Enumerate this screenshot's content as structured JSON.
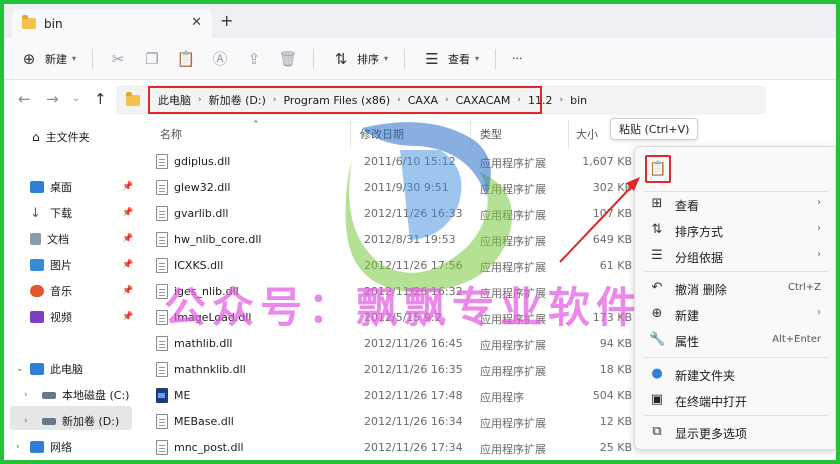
{
  "window": {
    "tab_title": "bin",
    "close_glyph": "✕",
    "add_tab_glyph": "+"
  },
  "toolbar": {
    "new_label": "新建",
    "sort_label": "排序",
    "view_label": "查看",
    "more_glyph": "···"
  },
  "address": {
    "crumbs": [
      "此电脑",
      "新加卷 (D:)",
      "Program Files (x86)",
      "CAXA",
      "CAXACAM",
      "11.2",
      "bin"
    ]
  },
  "sidebar": {
    "home": "主文件夹",
    "quick": [
      "桌面",
      "下载",
      "文档",
      "图片",
      "音乐",
      "视频"
    ],
    "this_pc": "此电脑",
    "drive_c": "本地磁盘 (C:)",
    "drive_d": "新加卷 (D:)",
    "network": "网络"
  },
  "columns": {
    "name": "名称",
    "modified": "修改日期",
    "type": "类型",
    "size": "大小"
  },
  "files": [
    {
      "name": "gdiplus.dll",
      "modified": "2011/6/10 15:12",
      "type": "应用程序扩展",
      "size": "1,607 KB",
      "icon": "dll"
    },
    {
      "name": "glew32.dll",
      "modified": "2011/9/30 9:51",
      "type": "应用程序扩展",
      "size": "302 KB",
      "icon": "dll"
    },
    {
      "name": "gvarlib.dll",
      "modified": "2012/11/26 16:33",
      "type": "应用程序扩展",
      "size": "107 KB",
      "icon": "dll"
    },
    {
      "name": "hw_nlib_core.dll",
      "modified": "2012/8/31 19:53",
      "type": "应用程序扩展",
      "size": "649 KB",
      "icon": "dll"
    },
    {
      "name": "ICXKS.dll",
      "modified": "2012/11/26 17:56",
      "type": "应用程序扩展",
      "size": "61 KB",
      "icon": "dll"
    },
    {
      "name": "iges_nlib.dll",
      "modified": "2012/11/26 16:32",
      "type": "应用程序扩展",
      "size": "",
      "icon": "dll"
    },
    {
      "name": "ImageLoad.dll",
      "modified": "2012/5/15 9:2",
      "type": "应用程序扩展",
      "size": "173 KB",
      "icon": "dll"
    },
    {
      "name": "mathlib.dll",
      "modified": "2012/11/26 16:45",
      "type": "应用程序扩展",
      "size": "94 KB",
      "icon": "dll"
    },
    {
      "name": "mathnklib.dll",
      "modified": "2012/11/26 16:35",
      "type": "应用程序扩展",
      "size": "18 KB",
      "icon": "dll"
    },
    {
      "name": "ME",
      "modified": "2012/11/26 17:48",
      "type": "应用程序",
      "size": "504 KB",
      "icon": "app"
    },
    {
      "name": "MEBase.dll",
      "modified": "2012/11/26 16:34",
      "type": "应用程序扩展",
      "size": "12 KB",
      "icon": "dll"
    },
    {
      "name": "mnc_post.dll",
      "modified": "2012/11/26 17:34",
      "type": "应用程序扩展",
      "size": "25 KB",
      "icon": "dll"
    }
  ],
  "tooltip": "粘贴 (Ctrl+V)",
  "context_menu": {
    "view": "查看",
    "sort": "排序方式",
    "group": "分组依据",
    "undo": "撤消 删除",
    "undo_shortcut": "Ctrl+Z",
    "new": "新建",
    "properties": "属性",
    "properties_shortcut": "Alt+Enter",
    "new_folder": "新建文件夹",
    "terminal": "在终端中打开",
    "more_options": "显示更多选项"
  },
  "watermark_text": "公众号：飘飘专业软件",
  "colors": {
    "accent_red": "#e0262b",
    "watermark": "#e35ce2",
    "border_green": "#22c33a"
  }
}
